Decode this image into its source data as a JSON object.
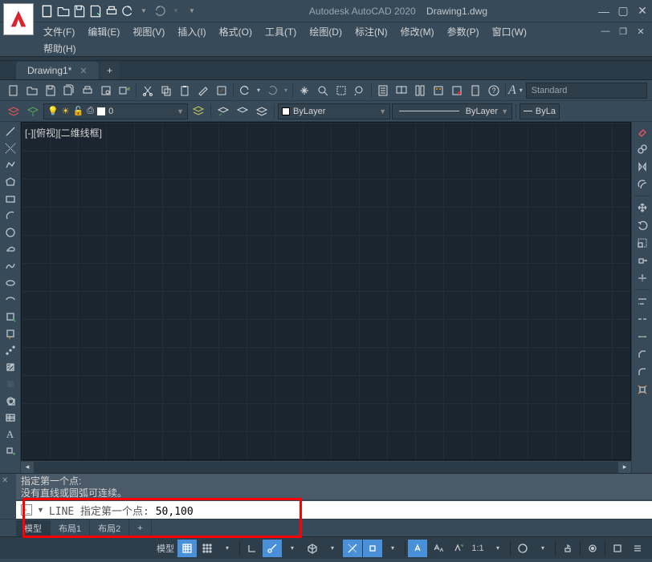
{
  "app": {
    "title": "Autodesk AutoCAD 2020",
    "filename": "Drawing1.dwg"
  },
  "menu": {
    "file": "文件(F)",
    "edit": "编辑(E)",
    "view": "视图(V)",
    "insert": "插入(I)",
    "format": "格式(O)",
    "tools": "工具(T)",
    "draw": "绘图(D)",
    "dimension": "标注(N)",
    "modify": "修改(M)",
    "parametric": "参数(P)",
    "window": "窗口(W)",
    "help": "帮助(H)"
  },
  "file_tab": {
    "name": "Drawing1*",
    "add": "+"
  },
  "text_style": {
    "label": "A",
    "value": "Standard"
  },
  "layer": {
    "name": "0",
    "bylayer1": "ByLayer",
    "bylayer2": "ByLayer",
    "bylayer3": "ByLa"
  },
  "viewport": {
    "label": "[-][俯视][二维线框]"
  },
  "cmd": {
    "hist1": "指定第一个点:",
    "hist2": "没有直线或圆弧可连续。",
    "prompt": "LINE 指定第一个点:",
    "input": "50,100"
  },
  "layout_tabs": {
    "model": "模型",
    "l1": "布局1",
    "l2": "布局2",
    "add": "+"
  },
  "status": {
    "model": "模型",
    "scale": "1:1"
  }
}
